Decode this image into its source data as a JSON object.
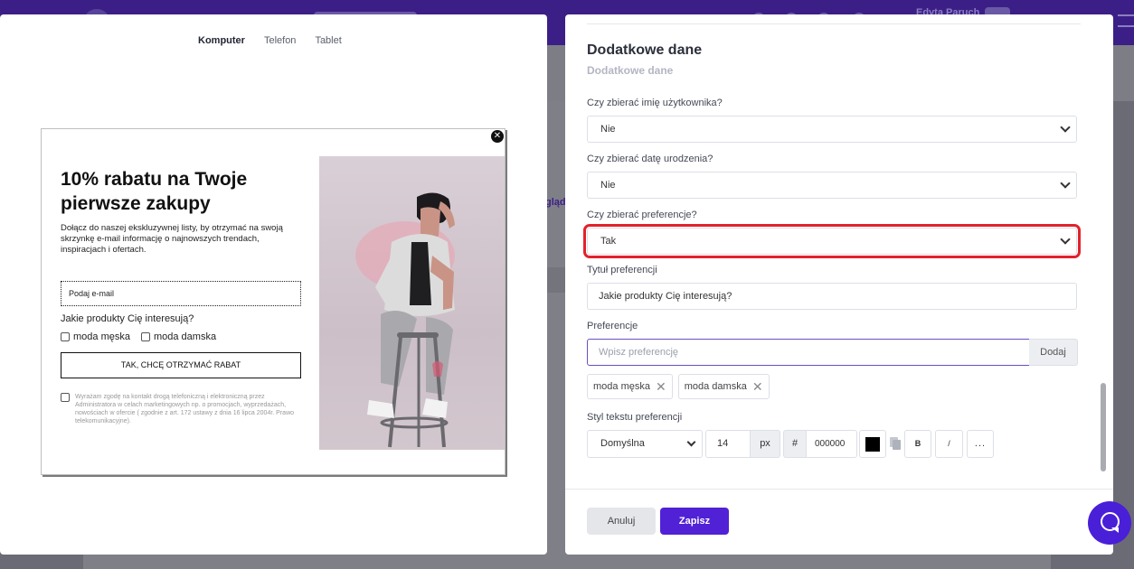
{
  "background": {
    "user_name": "Edyta Paruch",
    "partial_tab": "glądı"
  },
  "preview": {
    "devices": [
      "Komputer",
      "Telefon",
      "Tablet"
    ],
    "popup": {
      "close_glyph": "✕",
      "title": "10% rabatu na Twoje pierwsze zakupy",
      "description": "Dołącz do naszej ekskluzywnej listy, by otrzymać na swoją skrzynkę e-mail informację o najnowszych trendach, inspiracjach i ofertach.",
      "email_placeholder": "Podaj e-mail",
      "preferences_title": "Jakie produkty Cię interesują?",
      "options": [
        "moda męska",
        "moda damska"
      ],
      "cta": "TAK, CHCĘ OTRZYMAĆ RABAT",
      "consent": "Wyrażam zgodę na kontakt drogą telefoniczną i elektroniczną przez Administratora w celach marketingowych np. o promocjach, wyprzedażach, nowościach w ofercie ( zgodnie z art. 172 ustawy z dnia 16 lipca 2004r. Prawo telekomunikacyjne)."
    }
  },
  "settings": {
    "title": "Dodatkowe dane",
    "subtitle": "Dodatkowe dane",
    "collect_name_label": "Czy zbierać imię użytkownika?",
    "collect_name_value": "Nie",
    "collect_birthdate_label": "Czy zbierać datę urodzenia?",
    "collect_birthdate_value": "Nie",
    "collect_preferences_label": "Czy zbierać preferencje?",
    "collect_preferences_value": "Tak",
    "preferences_title_label": "Tytuł preferencji",
    "preferences_title_value": "Jakie produkty Cię interesują?",
    "preferences_label": "Preferencje",
    "preferences_placeholder": "Wpisz preferencję",
    "add_button": "Dodaj",
    "tags": [
      "moda męska",
      "moda damska"
    ],
    "text_style_label": "Styl tekstu preferencji",
    "font_value": "Domyślna",
    "size_value": "14",
    "size_unit": "px",
    "hash": "#",
    "color_hex": "000000",
    "swatch_color": "#000000",
    "bold_label": "B",
    "italic_label": "/",
    "more_label": "...",
    "cancel_button": "Anuluj",
    "save_button": "Zapisz",
    "accent_color": "#5121d6",
    "highlight_color": "#e3212b"
  }
}
